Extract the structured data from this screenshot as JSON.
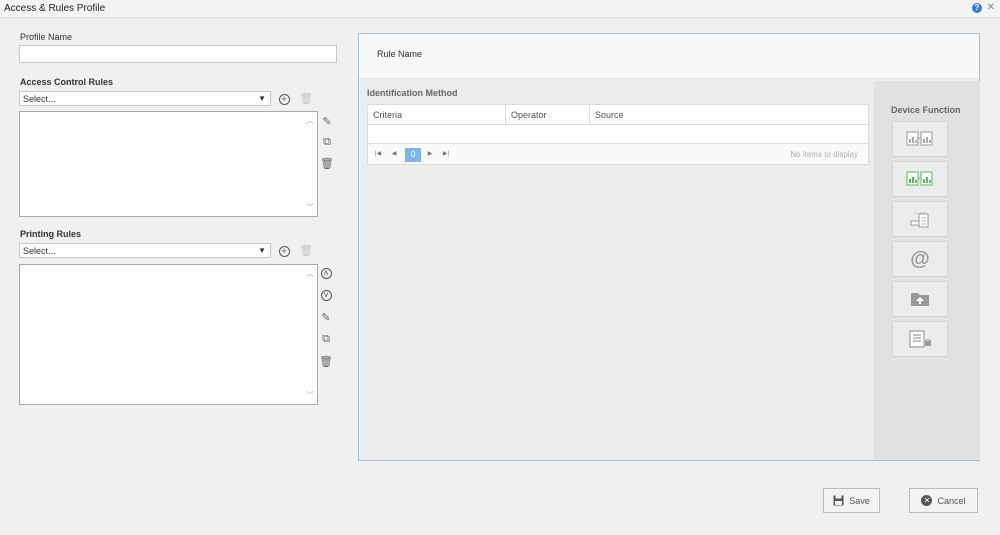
{
  "window": {
    "title": "Access & Rules Profile"
  },
  "profile": {
    "name_label": "Profile Name",
    "name_value": ""
  },
  "access_rules": {
    "label": "Access Control Rules",
    "select_value": "Select..."
  },
  "printing_rules": {
    "label": "Printing Rules",
    "select_value": "Select..."
  },
  "rule": {
    "name_label": "Rule Name",
    "identification_label": "Identification Method",
    "columns": [
      "Criteria",
      "Operator",
      "Source"
    ],
    "pager": {
      "current_page": "0",
      "empty_text": "No items to display"
    }
  },
  "device": {
    "label": "Device Function",
    "functions": [
      "copy-function-icon",
      "copy-active-function-icon",
      "scan-function-icon",
      "email-function-icon",
      "folder-upload-function-icon",
      "fax-function-icon"
    ],
    "accent_green": "#5cb85c"
  },
  "footer": {
    "save_label": "Save",
    "cancel_label": "Cancel"
  }
}
